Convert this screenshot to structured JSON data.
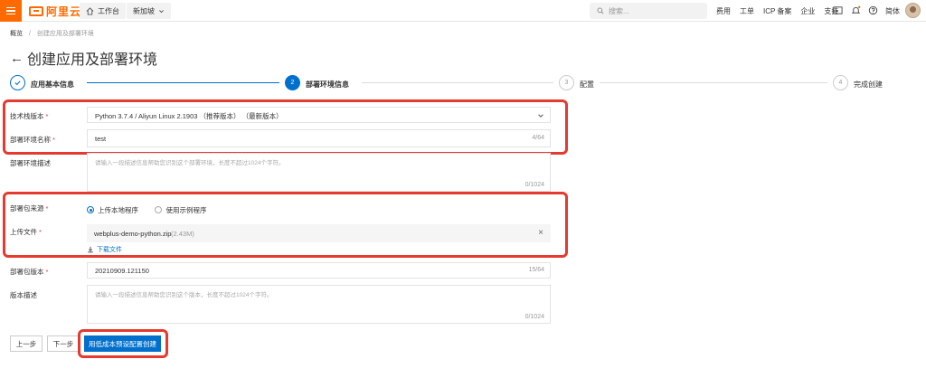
{
  "topbar": {
    "brand": "阿里云",
    "workbench": "工作台",
    "region": "新加坡",
    "search_placeholder": "搜索...",
    "links": [
      "费用",
      "工单",
      "ICP 备案",
      "企业",
      "支持"
    ],
    "lang": "简体"
  },
  "breadcrumb": {
    "root": "概览",
    "separator": "/",
    "current": "创建应用及部署环境"
  },
  "page": {
    "title": "创建应用及部署环境"
  },
  "steps": [
    {
      "index": "1",
      "label": "应用基本信息",
      "state": "done"
    },
    {
      "index": "2",
      "label": "部署环境信息",
      "state": "active"
    },
    {
      "index": "3",
      "label": "配置",
      "state": "pending"
    },
    {
      "index": "4",
      "label": "完成创建",
      "state": "pending"
    }
  ],
  "form": {
    "stack_label": "技术栈版本",
    "stack_value": "Python 3.7.4 / Aliyun Linux 2.1903 （推荐版本） （最新版本）",
    "env_name_label": "部署环境名称",
    "env_name_value": "test",
    "env_name_counter": "4/64",
    "env_desc_label": "部署环境描述",
    "env_desc_placeholder": "请输入一段描述信息帮助您识别这个部署环境，长度不超过1024个字符。",
    "env_desc_counter": "0/1024",
    "source_label": "部署包来源",
    "source_option_local": "上传本地程序",
    "source_option_sample": "使用示例程序",
    "upload_label": "上传文件",
    "upload_filename": "webplus-demo-python.zip",
    "upload_size": "(2.43M)",
    "download_link": "下载文件",
    "pkg_version_label": "部署包版本",
    "pkg_version_value": "20210909.121150",
    "pkg_version_counter": "15/64",
    "version_desc_label": "版本描述",
    "version_desc_placeholder": "请输入一段描述信息帮助您识别这个版本，长度不超过1024个字符。",
    "version_desc_counter": "0/1024"
  },
  "actions": {
    "prev": "上一步",
    "next": "下一步",
    "create": "用低成本预设配置创建"
  },
  "colors": {
    "brand_orange": "#ff6a00",
    "primary_blue": "#0070cc",
    "highlight_red": "#e53a2f"
  }
}
